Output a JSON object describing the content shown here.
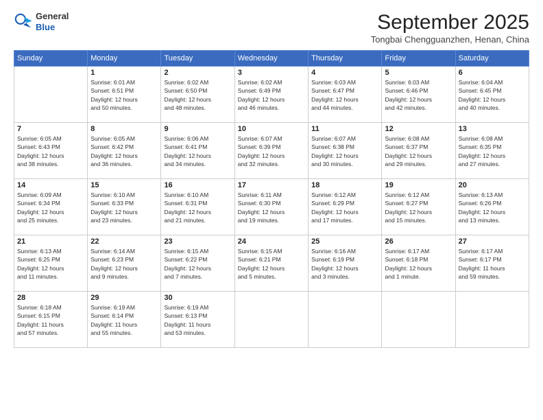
{
  "header": {
    "logo_general": "General",
    "logo_blue": "Blue",
    "main_title": "September 2025",
    "subtitle": "Tongbai Chengguanzhen, Henan, China"
  },
  "calendar": {
    "headers": [
      "Sunday",
      "Monday",
      "Tuesday",
      "Wednesday",
      "Thursday",
      "Friday",
      "Saturday"
    ],
    "weeks": [
      [
        {
          "day": "",
          "info": ""
        },
        {
          "day": "1",
          "info": "Sunrise: 6:01 AM\nSunset: 6:51 PM\nDaylight: 12 hours\nand 50 minutes."
        },
        {
          "day": "2",
          "info": "Sunrise: 6:02 AM\nSunset: 6:50 PM\nDaylight: 12 hours\nand 48 minutes."
        },
        {
          "day": "3",
          "info": "Sunrise: 6:02 AM\nSunset: 6:49 PM\nDaylight: 12 hours\nand 46 minutes."
        },
        {
          "day": "4",
          "info": "Sunrise: 6:03 AM\nSunset: 6:47 PM\nDaylight: 12 hours\nand 44 minutes."
        },
        {
          "day": "5",
          "info": "Sunrise: 6:03 AM\nSunset: 6:46 PM\nDaylight: 12 hours\nand 42 minutes."
        },
        {
          "day": "6",
          "info": "Sunrise: 6:04 AM\nSunset: 6:45 PM\nDaylight: 12 hours\nand 40 minutes."
        }
      ],
      [
        {
          "day": "7",
          "info": "Sunrise: 6:05 AM\nSunset: 6:43 PM\nDaylight: 12 hours\nand 38 minutes."
        },
        {
          "day": "8",
          "info": "Sunrise: 6:05 AM\nSunset: 6:42 PM\nDaylight: 12 hours\nand 36 minutes."
        },
        {
          "day": "9",
          "info": "Sunrise: 6:06 AM\nSunset: 6:41 PM\nDaylight: 12 hours\nand 34 minutes."
        },
        {
          "day": "10",
          "info": "Sunrise: 6:07 AM\nSunset: 6:39 PM\nDaylight: 12 hours\nand 32 minutes."
        },
        {
          "day": "11",
          "info": "Sunrise: 6:07 AM\nSunset: 6:38 PM\nDaylight: 12 hours\nand 30 minutes."
        },
        {
          "day": "12",
          "info": "Sunrise: 6:08 AM\nSunset: 6:37 PM\nDaylight: 12 hours\nand 29 minutes."
        },
        {
          "day": "13",
          "info": "Sunrise: 6:08 AM\nSunset: 6:35 PM\nDaylight: 12 hours\nand 27 minutes."
        }
      ],
      [
        {
          "day": "14",
          "info": "Sunrise: 6:09 AM\nSunset: 6:34 PM\nDaylight: 12 hours\nand 25 minutes."
        },
        {
          "day": "15",
          "info": "Sunrise: 6:10 AM\nSunset: 6:33 PM\nDaylight: 12 hours\nand 23 minutes."
        },
        {
          "day": "16",
          "info": "Sunrise: 6:10 AM\nSunset: 6:31 PM\nDaylight: 12 hours\nand 21 minutes."
        },
        {
          "day": "17",
          "info": "Sunrise: 6:11 AM\nSunset: 6:30 PM\nDaylight: 12 hours\nand 19 minutes."
        },
        {
          "day": "18",
          "info": "Sunrise: 6:12 AM\nSunset: 6:29 PM\nDaylight: 12 hours\nand 17 minutes."
        },
        {
          "day": "19",
          "info": "Sunrise: 6:12 AM\nSunset: 6:27 PM\nDaylight: 12 hours\nand 15 minutes."
        },
        {
          "day": "20",
          "info": "Sunrise: 6:13 AM\nSunset: 6:26 PM\nDaylight: 12 hours\nand 13 minutes."
        }
      ],
      [
        {
          "day": "21",
          "info": "Sunrise: 6:13 AM\nSunset: 6:25 PM\nDaylight: 12 hours\nand 11 minutes."
        },
        {
          "day": "22",
          "info": "Sunrise: 6:14 AM\nSunset: 6:23 PM\nDaylight: 12 hours\nand 9 minutes."
        },
        {
          "day": "23",
          "info": "Sunrise: 6:15 AM\nSunset: 6:22 PM\nDaylight: 12 hours\nand 7 minutes."
        },
        {
          "day": "24",
          "info": "Sunrise: 6:15 AM\nSunset: 6:21 PM\nDaylight: 12 hours\nand 5 minutes."
        },
        {
          "day": "25",
          "info": "Sunrise: 6:16 AM\nSunset: 6:19 PM\nDaylight: 12 hours\nand 3 minutes."
        },
        {
          "day": "26",
          "info": "Sunrise: 6:17 AM\nSunset: 6:18 PM\nDaylight: 12 hours\nand 1 minute."
        },
        {
          "day": "27",
          "info": "Sunrise: 6:17 AM\nSunset: 6:17 PM\nDaylight: 11 hours\nand 59 minutes."
        }
      ],
      [
        {
          "day": "28",
          "info": "Sunrise: 6:18 AM\nSunset: 6:15 PM\nDaylight: 11 hours\nand 57 minutes."
        },
        {
          "day": "29",
          "info": "Sunrise: 6:19 AM\nSunset: 6:14 PM\nDaylight: 11 hours\nand 55 minutes."
        },
        {
          "day": "30",
          "info": "Sunrise: 6:19 AM\nSunset: 6:13 PM\nDaylight: 11 hours\nand 53 minutes."
        },
        {
          "day": "",
          "info": ""
        },
        {
          "day": "",
          "info": ""
        },
        {
          "day": "",
          "info": ""
        },
        {
          "day": "",
          "info": ""
        }
      ]
    ]
  }
}
